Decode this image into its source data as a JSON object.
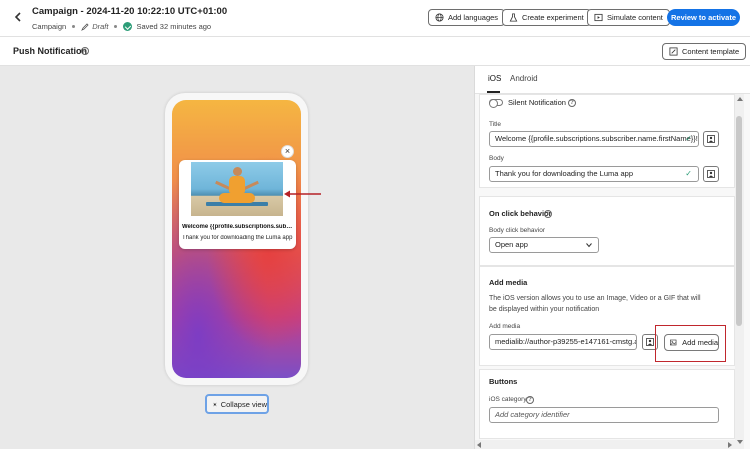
{
  "header": {
    "back_icon": "chevron-left-icon",
    "title": "Campaign - 2024-11-20 10:22:10 UTC+01:00",
    "type": "Campaign",
    "status": "Draft",
    "saved": "Saved 32 minutes ago",
    "buttons": {
      "add_languages": "Add languages",
      "create_experiment": "Create experiment",
      "simulate_content": "Simulate content",
      "review": "Review to activate"
    }
  },
  "subheader": {
    "title": "Push Notification",
    "content_template": "Content template"
  },
  "preview": {
    "notification": {
      "title": "Welcome {{profile.subscriptions.subscr...",
      "body": "Thank you for downloading the Luma app",
      "close": "×"
    },
    "collapse_view": "Collapse view"
  },
  "panel": {
    "tabs": [
      {
        "label": "iOS",
        "active": true
      },
      {
        "label": "Android",
        "active": false
      }
    ],
    "silent_notification": "Silent Notification",
    "title_label": "Title",
    "title_value": "Welcome {{profile.subscriptions.subscriber.name.firstName}}!",
    "body_label": "Body",
    "body_value": "Thank you for downloading the Luma app",
    "on_click": {
      "heading": "On click behavior",
      "label": "Body click behavior",
      "value": "Open app"
    },
    "add_media": {
      "heading": "Add media",
      "description": "The iOS version allows you to use an Image, Video or a GIF that will be displayed within your notification",
      "label": "Add media",
      "value": "medialib://author-p39255-e147161-cmstg.ad...",
      "button": "Add media"
    },
    "buttons": {
      "heading": "Buttons",
      "category_label": "iOS category",
      "category_placeholder": "Add category identifier"
    }
  },
  "colors": {
    "accent": "#1473e6",
    "success": "#2d9d78",
    "highlight": "#c0272d"
  }
}
